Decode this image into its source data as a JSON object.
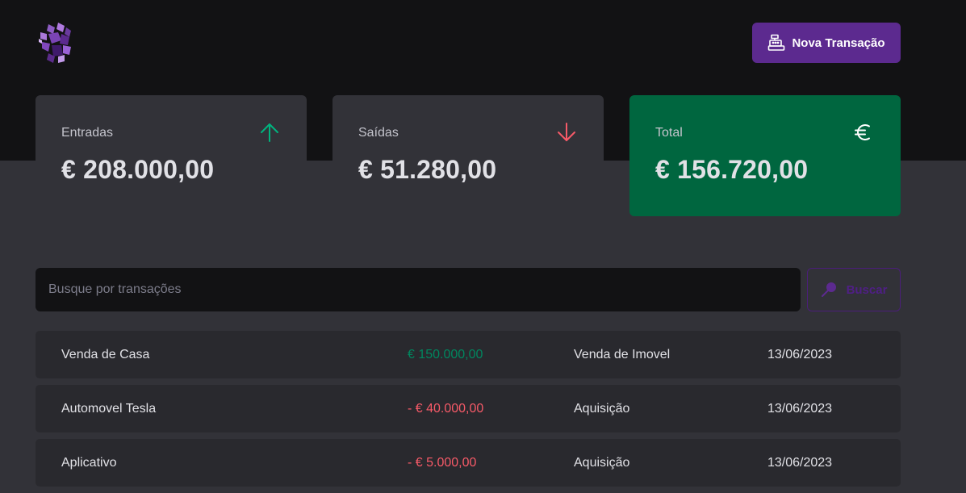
{
  "header": {
    "new_transaction_label": "Nova Transação",
    "logo_icon": "ignite-logo-icon",
    "new_transaction_icon": "cash-register-icon"
  },
  "summary": [
    {
      "label": "Entradas",
      "value": "€ 208.000,00",
      "icon": "arrow-up-icon",
      "icon_color": "#00b37e"
    },
    {
      "label": "Saídas",
      "value": "€ 51.280,00",
      "icon": "arrow-down-icon",
      "icon_color": "#f75a68"
    },
    {
      "label": "Total",
      "value": "€ 156.720,00",
      "icon": "euro-icon",
      "icon_color": "#ffffff"
    }
  ],
  "search": {
    "placeholder": "Busque por transações",
    "button_label": "Buscar",
    "button_icon": "magnifier-icon"
  },
  "transactions": [
    {
      "description": "Venda de Casa",
      "price": "€ 150.000,00",
      "type": "income",
      "category": "Venda de Imovel",
      "date": "13/06/2023"
    },
    {
      "description": "Automovel Tesla",
      "price": "- € 40.000,00",
      "type": "outcome",
      "category": "Aquisição",
      "date": "13/06/2023"
    },
    {
      "description": "Aplicativo",
      "price": "- € 5.000,00",
      "type": "outcome",
      "category": "Aquisição",
      "date": "13/06/2023"
    }
  ],
  "colors": {
    "background": "#323238",
    "header_background": "#121214",
    "brand": "#5c2a8f",
    "total_card": "#00663f",
    "income": "#00875f",
    "outcome": "#f75a68"
  }
}
